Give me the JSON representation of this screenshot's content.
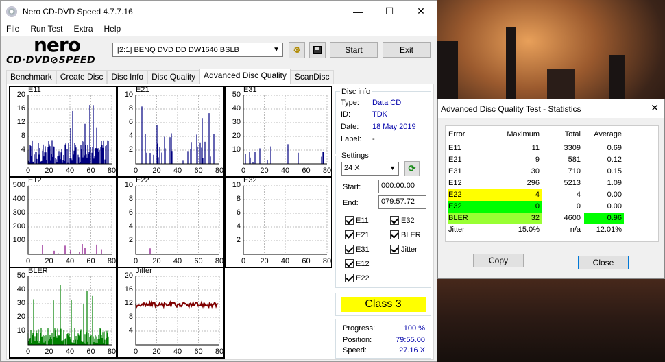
{
  "app": {
    "title": "Nero CD-DVD Speed 4.7.7.16",
    "minimize": "—",
    "maximize": "☐",
    "close": "✕"
  },
  "logo": {
    "line1": "nero",
    "line2": "CD·DVD⊘SPEED"
  },
  "menu": [
    "File",
    "Run Test",
    "Extra",
    "Help"
  ],
  "toolbar": {
    "drive": "[2:1]   BENQ DVD DD DW1640 BSLB",
    "start_label": "Start",
    "exit_label": "Exit"
  },
  "tabs": [
    "Benchmark",
    "Create Disc",
    "Disc Info",
    "Disc Quality",
    "Advanced Disc Quality",
    "ScanDisc"
  ],
  "active_tab": "Advanced Disc Quality",
  "charts": [
    {
      "name": "E11",
      "yticks": [
        "20",
        "16",
        "12",
        "8",
        "4"
      ],
      "xticks": [
        "0",
        "20",
        "40",
        "60",
        "80"
      ],
      "color": "#000080"
    },
    {
      "name": "E21",
      "yticks": [
        "10",
        "8",
        "6",
        "4",
        "2"
      ],
      "xticks": [
        "0",
        "20",
        "40",
        "60",
        "80"
      ],
      "color": "#000080"
    },
    {
      "name": "E31",
      "yticks": [
        "50",
        "40",
        "30",
        "20",
        "10"
      ],
      "xticks": [
        "0",
        "20",
        "40",
        "60",
        "80"
      ],
      "color": "#000080"
    },
    {
      "name": "E12",
      "yticks": [
        "500",
        "400",
        "300",
        "200",
        "100"
      ],
      "xticks": [
        "0",
        "20",
        "40",
        "60",
        "80"
      ],
      "color": "#800080"
    },
    {
      "name": "E22",
      "yticks": [
        "10",
        "8",
        "6",
        "4",
        "2"
      ],
      "xticks": [
        "0",
        "20",
        "40",
        "60",
        "80"
      ],
      "color": "#800080"
    },
    {
      "name": "E32",
      "yticks": [
        "10",
        "8",
        "6",
        "4",
        "2"
      ],
      "xticks": [
        "0",
        "20",
        "40",
        "60",
        "80"
      ],
      "color": "#800080"
    },
    {
      "name": "BLER",
      "yticks": [
        "50",
        "40",
        "30",
        "20",
        "10"
      ],
      "xticks": [
        "0",
        "20",
        "40",
        "60",
        "80"
      ],
      "color": "#008000"
    },
    {
      "name": "Jitter",
      "yticks": [
        "20",
        "16",
        "12",
        "8",
        "4"
      ],
      "xticks": [
        "0",
        "20",
        "40",
        "60",
        "80"
      ],
      "color": "#800000"
    }
  ],
  "disc_info": {
    "title": "Disc info",
    "type_label": "Type:",
    "type": "Data CD",
    "id_label": "ID:",
    "id": "TDK",
    "date_label": "Date:",
    "date": "18 May 2019",
    "label_label": "Label:",
    "label": "-"
  },
  "settings": {
    "title": "Settings",
    "speed": "24 X",
    "start_label": "Start:",
    "start": "000:00.00",
    "end_label": "End:",
    "end": "079:57.72",
    "checks": [
      "E11",
      "E32",
      "E21",
      "BLER",
      "E31",
      "Jitter",
      "E12",
      "E22"
    ]
  },
  "class_badge": "Class 3",
  "progress": {
    "progress_label": "Progress:",
    "progress": "100 %",
    "position_label": "Position:",
    "position": "79:55.00",
    "speed_label": "Speed:",
    "speed": "27.16 X"
  },
  "stats": {
    "title": "Advanced Disc Quality Test - Statistics",
    "headers": [
      "Error",
      "Maximum",
      "Total",
      "Average"
    ],
    "rows": [
      [
        "E11",
        "11",
        "3309",
        "0.69"
      ],
      [
        "E21",
        "9",
        "581",
        "0.12"
      ],
      [
        "E31",
        "30",
        "710",
        "0.15"
      ],
      [
        "E12",
        "296",
        "5213",
        "1.09"
      ],
      [
        "E22",
        "4",
        "4",
        "0.00"
      ],
      [
        "E32",
        "0",
        "0",
        "0.00"
      ],
      [
        "BLER",
        "32",
        "4600",
        "0.96"
      ],
      [
        "Jitter",
        "15.0%",
        "n/a",
        "12.01%"
      ]
    ],
    "copy_label": "Copy",
    "close_label": "Close",
    "colors": {
      "yellow": "#ffff00",
      "green": "#00ff00",
      "lime": "#99ff33"
    }
  }
}
